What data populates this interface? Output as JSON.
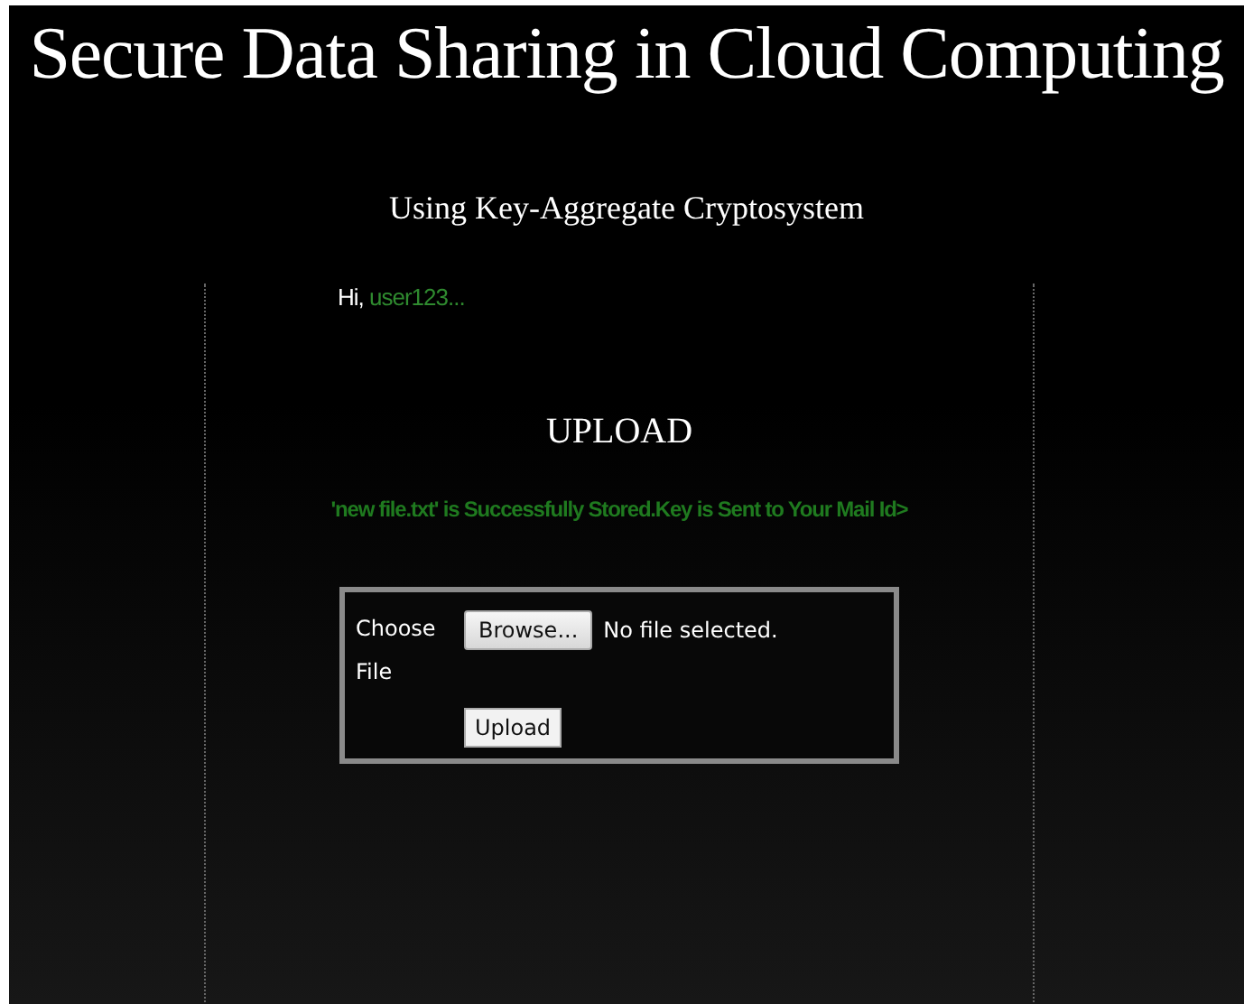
{
  "header": {
    "title": "Secure Data Sharing in Cloud Computing",
    "subtitle": "Using Key-Aggregate Cryptosystem"
  },
  "greeting": {
    "prefix": "Hi,",
    "username": "user123..."
  },
  "section_title": "UPLOAD",
  "message": "'new file.txt' is Successfully Stored.Key is Sent to Your Mail Id>",
  "upload_form": {
    "label": "Choose File",
    "browse_button": "Browse...",
    "file_status": "No file selected.",
    "submit_button": "Upload"
  }
}
